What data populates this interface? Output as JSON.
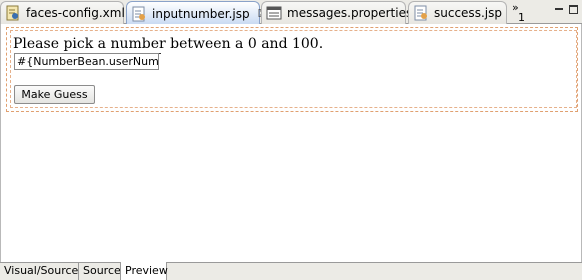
{
  "tabs": [
    {
      "label": "faces-config.xml",
      "icon": "faces-config-file-icon"
    },
    {
      "label": "inputnumber.jsp",
      "icon": "jsp-file-icon",
      "close": "☒"
    },
    {
      "label": "messages.properties",
      "icon": "properties-file-icon"
    },
    {
      "label": "success.jsp",
      "icon": "jsp-file-icon"
    }
  ],
  "overflow": {
    "chevron": "»",
    "count": "1"
  },
  "preview": {
    "prompt": "Please pick a number between a 0 and 100.",
    "input_value": "#{NumberBean.userNumber}",
    "guess_button": "Make Guess"
  },
  "bottom_tabs": [
    "Visual/Source",
    "Source",
    "Preview"
  ],
  "colors": {
    "active_tab": "#c7d9f2",
    "form_border": "#e0a070"
  }
}
